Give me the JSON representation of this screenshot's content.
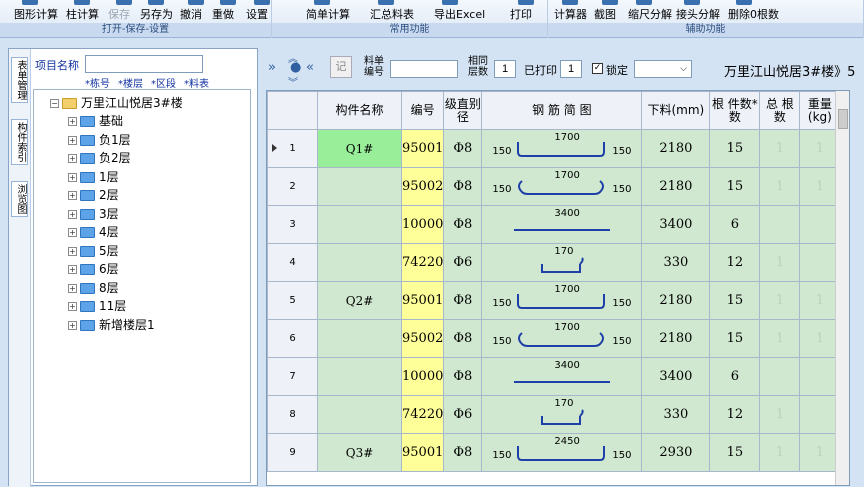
{
  "ribbon": {
    "groups": [
      {
        "label": "打开-保存-设置",
        "buttons": [
          {
            "label": "图形计算",
            "disabled": false
          },
          {
            "label": "柱计算",
            "disabled": false
          },
          {
            "label": "保存",
            "disabled": true
          },
          {
            "label": "另存为",
            "disabled": false
          },
          {
            "label": "撤消",
            "disabled": false
          },
          {
            "label": "重做",
            "disabled": false
          },
          {
            "label": "设置",
            "disabled": false
          }
        ]
      },
      {
        "label": "常用功能",
        "buttons": [
          {
            "label": "简单计算",
            "disabled": false
          },
          {
            "label": "汇总料表",
            "disabled": false
          },
          {
            "label": "导出Excel",
            "disabled": false
          },
          {
            "label": "打印",
            "disabled": false
          }
        ]
      },
      {
        "label": "辅助功能",
        "buttons": [
          {
            "label": "计算器",
            "disabled": false
          },
          {
            "label": "截图",
            "disabled": false
          },
          {
            "label": "缩尺分解",
            "disabled": false
          },
          {
            "label": "接头分解",
            "disabled": false
          },
          {
            "label": "删除0根数",
            "disabled": false
          }
        ]
      }
    ]
  },
  "left": {
    "vertical_tabs": [
      "表单管理",
      "构件索引",
      "浏览图"
    ],
    "project_label": "项目名称",
    "project_value": "",
    "filters": [
      "*栋号",
      "*楼层",
      "*区段",
      "*料表"
    ],
    "tree_root": "万里江山悦居3#楼",
    "tree_children": [
      "基础",
      "负1层",
      "负2层",
      "1层",
      "2层",
      "3层",
      "4层",
      "5层",
      "6层",
      "8层",
      "11层",
      "新增楼层1"
    ]
  },
  "toolbar": {
    "record_label": "记",
    "sheet_no_label": "料单编号",
    "sheet_no_value": "",
    "same_floors_label": "相同层数",
    "same_floors_value": "1",
    "printed_label": "已打印",
    "printed_value": "1",
    "lock_label": "锁定",
    "lock_checked": true,
    "dropdown_value": "",
    "breadcrumb": "万里江山悦居3#楼》5"
  },
  "table": {
    "headers": [
      "构件名称",
      "编号",
      "级直别径",
      "钢 筋 简 图",
      "下料(mm)",
      "根 件数*数",
      "总 根 数",
      "重量(kg)"
    ],
    "rows": [
      {
        "idx": "1",
        "member": "Q1#",
        "code": "95001",
        "grade": "Φ8",
        "shape": "U",
        "dims": {
          "top": "1700",
          "left": "150",
          "right": "150"
        },
        "length": "2180",
        "count": "15",
        "total": "1",
        "weight": "1"
      },
      {
        "idx": "2",
        "member": "",
        "code": "95002",
        "grade": "Φ8",
        "shape": "UD",
        "dims": {
          "top": "1700",
          "left": "150",
          "right": "150"
        },
        "length": "2180",
        "count": "15",
        "total": "1",
        "weight": "1"
      },
      {
        "idx": "3",
        "member": "",
        "code": "10000",
        "grade": "Φ8",
        "shape": "L",
        "dims": {
          "top": "3400"
        },
        "length": "3400",
        "count": "6",
        "total": "",
        "weight": ""
      },
      {
        "idx": "4",
        "member": "",
        "code": "74220",
        "grade": "Φ6",
        "shape": "S",
        "dims": {
          "top": "170"
        },
        "length": "330",
        "count": "12",
        "total": "1",
        "weight": ""
      },
      {
        "idx": "5",
        "member": "Q2#",
        "code": "95001",
        "grade": "Φ8",
        "shape": "U",
        "dims": {
          "top": "1700",
          "left": "150",
          "right": "150"
        },
        "length": "2180",
        "count": "15",
        "total": "1",
        "weight": "1"
      },
      {
        "idx": "6",
        "member": "",
        "code": "95002",
        "grade": "Φ8",
        "shape": "UD",
        "dims": {
          "top": "1700",
          "left": "150",
          "right": "150"
        },
        "length": "2180",
        "count": "15",
        "total": "1",
        "weight": "1"
      },
      {
        "idx": "7",
        "member": "",
        "code": "10000",
        "grade": "Φ8",
        "shape": "L",
        "dims": {
          "top": "3400"
        },
        "length": "3400",
        "count": "6",
        "total": "",
        "weight": ""
      },
      {
        "idx": "8",
        "member": "",
        "code": "74220",
        "grade": "Φ6",
        "shape": "S",
        "dims": {
          "top": "170"
        },
        "length": "330",
        "count": "12",
        "total": "1",
        "weight": ""
      },
      {
        "idx": "9",
        "member": "Q3#",
        "code": "95001",
        "grade": "Φ8",
        "shape": "U",
        "dims": {
          "top": "2450",
          "left": "150",
          "right": "150"
        },
        "length": "2930",
        "count": "15",
        "total": "1",
        "weight": "1"
      }
    ]
  }
}
